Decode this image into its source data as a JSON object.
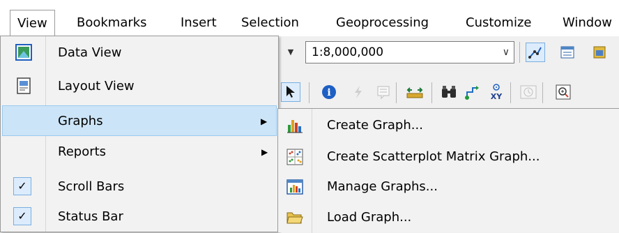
{
  "menubar": {
    "items": [
      {
        "label": "View",
        "active": true
      },
      {
        "label": "Bookmarks"
      },
      {
        "label": "Insert"
      },
      {
        "label": "Selection"
      },
      {
        "label": "Geoprocessing"
      },
      {
        "label": "Customize"
      },
      {
        "label": "Window"
      }
    ]
  },
  "toolbar": {
    "scale_value": "1:8,000,000",
    "icons": [
      "select-elements-icon",
      "identify-icon",
      "hyperlink-icon",
      "html-popup-icon",
      "measure-icon",
      "find-icon",
      "find-route-icon",
      "go-to-xy-icon",
      "time-slider-icon",
      "create-viewer-window-icon",
      "editor-toolbar-icon",
      "table-of-contents-icon",
      "catalog-icon"
    ]
  },
  "view_menu": {
    "items": [
      {
        "label": "Data View",
        "icon": "data-view-icon"
      },
      {
        "label": "Layout View",
        "icon": "layout-view-icon"
      },
      {
        "label": "Graphs",
        "has_submenu": true,
        "highlighted": true
      },
      {
        "label": "Reports",
        "has_submenu": true
      },
      {
        "label": "Scroll Bars",
        "checked": true
      },
      {
        "label": "Status Bar",
        "checked": true
      }
    ]
  },
  "graphs_submenu": {
    "items": [
      {
        "label": "Create Graph...",
        "icon": "create-graph-icon"
      },
      {
        "label": "Create Scatterplot Matrix Graph...",
        "icon": "scatterplot-matrix-icon"
      },
      {
        "label": "Manage Graphs...",
        "icon": "manage-graphs-icon"
      },
      {
        "label": "Load Graph...",
        "icon": "load-graph-folder-icon"
      }
    ]
  },
  "colors": {
    "hover_bg": "#cce4f7",
    "hover_border": "#99c9ef",
    "menu_bg": "#f2f2f2"
  }
}
